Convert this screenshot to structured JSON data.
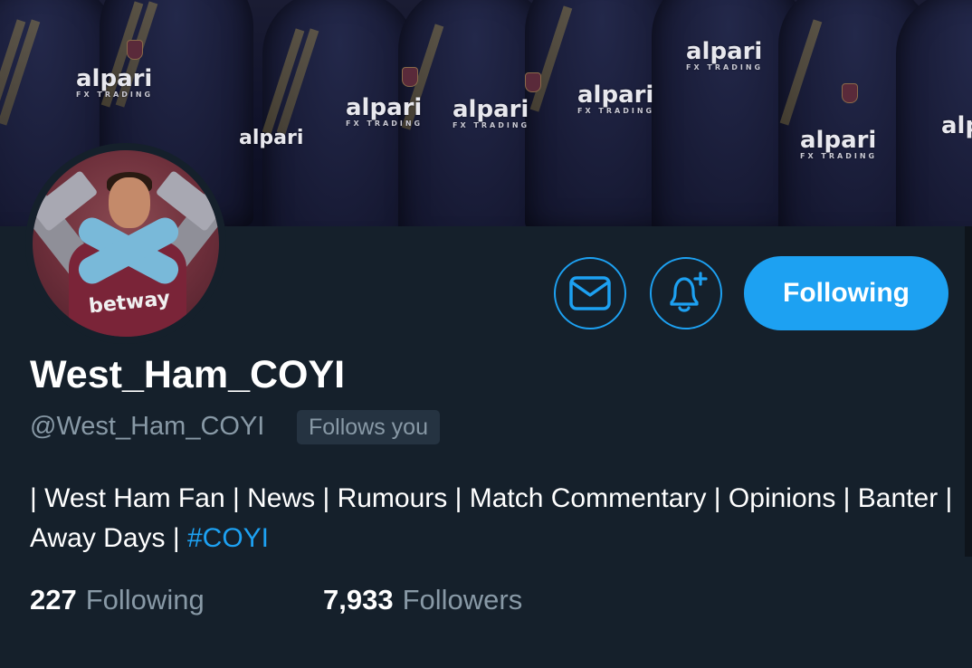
{
  "banner": {
    "sponsor_text": "alpari",
    "sponsor_subtext": "FX TRADING"
  },
  "avatar": {
    "shirt_text": "betway"
  },
  "actions": {
    "message_icon": "envelope-icon",
    "notify_icon": "bell-plus-icon",
    "follow_label": "Following",
    "accent_color": "#1da1f2"
  },
  "profile": {
    "display_name": "West_Ham_COYI",
    "handle": "@West_Ham_COYI",
    "follows_you": "Follows you",
    "bio_text": "| West Ham Fan | News | Rumours | Match Commentary | Opinions | Banter | Away Days | ",
    "bio_hashtag": "#COYI"
  },
  "stats": {
    "following_count": "227",
    "following_label": "Following",
    "followers_count": "7,933",
    "followers_label": "Followers"
  }
}
